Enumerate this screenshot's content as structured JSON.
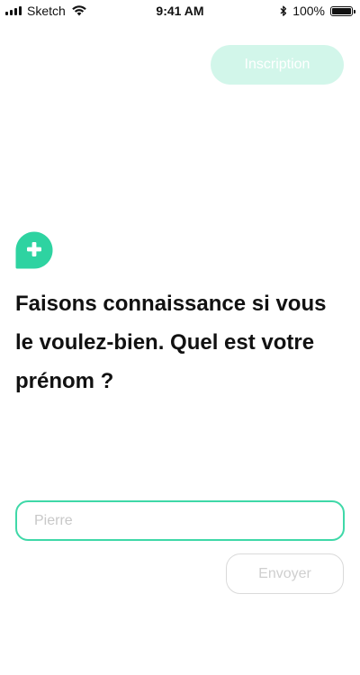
{
  "status_bar": {
    "carrier": "Sketch",
    "time": "9:41 AM",
    "battery": "100%",
    "icons": [
      "signal-icon",
      "wifi-icon",
      "bluetooth-icon",
      "battery-icon"
    ]
  },
  "header": {
    "signup_label": "Inscription"
  },
  "main": {
    "icon": "chat-plus-icon",
    "question": "Faisons connaissance si vous le voulez-bien. Quel est votre prénom ?"
  },
  "form": {
    "name_placeholder": "Pierre",
    "name_value": "",
    "send_label": "Envoyer"
  },
  "colors": {
    "accent": "#2ed3a1",
    "accent_light": "#d2f6ea",
    "input_border": "#3fd8a8",
    "disabled_text": "#cfcfcf",
    "text": "#111111"
  }
}
